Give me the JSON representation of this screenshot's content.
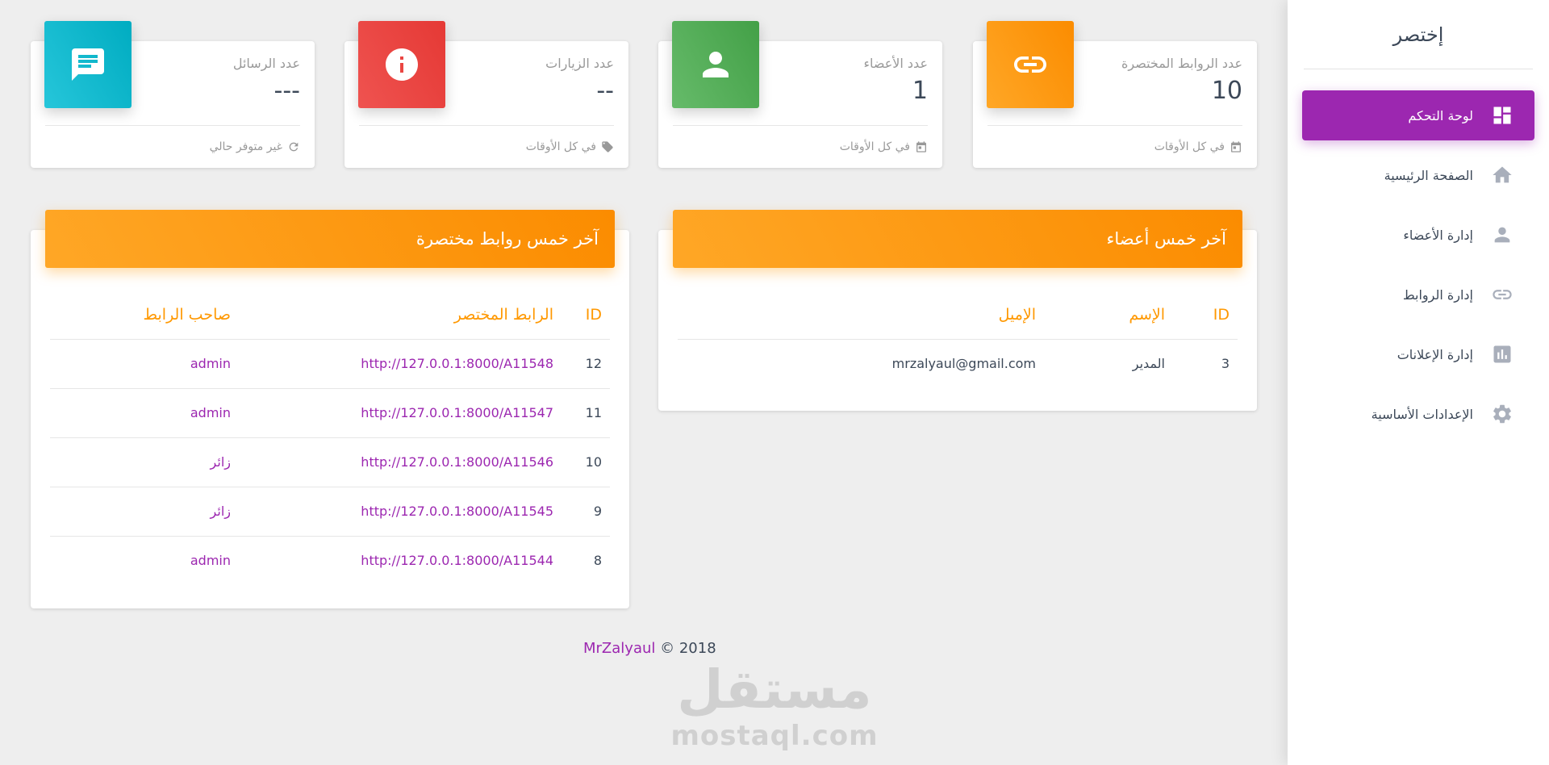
{
  "sidebar": {
    "brand": "إختصر",
    "items": [
      {
        "label": "لوحة التحكم",
        "icon": "dashboard-icon",
        "active": true
      },
      {
        "label": "الصفحة الرئيسية",
        "icon": "home-icon",
        "active": false
      },
      {
        "label": "إدارة الأعضاء",
        "icon": "person-icon",
        "active": false
      },
      {
        "label": "إدارة الروابط",
        "icon": "link-icon",
        "active": false
      },
      {
        "label": "إدارة الإعلانات",
        "icon": "bar-chart-icon",
        "active": false
      },
      {
        "label": "الإعدادات الأساسية",
        "icon": "gear-icon",
        "active": false
      }
    ]
  },
  "stats": {
    "links": {
      "title": "عدد الروابط المختصرة",
      "value": "10",
      "footer": "في كل الأوقات",
      "icon": "link-icon",
      "color": "#fb8c00"
    },
    "members": {
      "title": "عدد الأعضاء",
      "value": "1",
      "footer": "في كل الأوقات",
      "icon": "person-icon",
      "color": "#43a047"
    },
    "visits": {
      "title": "عدد الزيارات",
      "value": "--",
      "footer": "في كل الأوقات",
      "icon": "info-icon",
      "color": "#e53935"
    },
    "messages": {
      "title": "عدد الرسائل",
      "value": "---",
      "footer": "غير متوفر حالي",
      "icon": "chat-icon",
      "color": "#00acc1"
    }
  },
  "members_table": {
    "title": "آخر خمس أعضاء",
    "headers": [
      "ID",
      "الإسم",
      "الإميل"
    ],
    "rows": [
      {
        "id": "3",
        "name": "المدير",
        "email": "mrzalyaul@gmail.com"
      }
    ]
  },
  "links_table": {
    "title": "آخر خمس روابط مختصرة",
    "headers": [
      "ID",
      "الرابط المختصر",
      "صاحب الرابط"
    ],
    "rows": [
      {
        "id": "12",
        "url": "http://127.0.0.1:8000/A11548",
        "owner": "admin"
      },
      {
        "id": "11",
        "url": "http://127.0.0.1:8000/A11547",
        "owner": "admin"
      },
      {
        "id": "10",
        "url": "http://127.0.0.1:8000/A11546",
        "owner": "زائر"
      },
      {
        "id": "9",
        "url": "http://127.0.0.1:8000/A11545",
        "owner": "زائر"
      },
      {
        "id": "8",
        "url": "http://127.0.0.1:8000/A11544",
        "owner": "admin"
      }
    ]
  },
  "footer": {
    "author": "MrZalyaul",
    "copyright": "© 2018"
  },
  "watermark": {
    "arabic": "مستقل",
    "latin": "mostaql.com"
  },
  "colors": {
    "primary": "#9c27b0",
    "accent": "#ff9800"
  }
}
